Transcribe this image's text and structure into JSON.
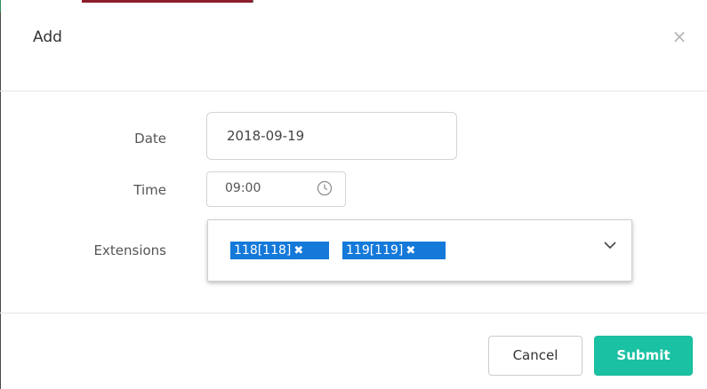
{
  "dialog": {
    "title": "Add",
    "close_glyph": "×"
  },
  "form": {
    "date": {
      "label": "Date",
      "value": "2018-09-19"
    },
    "time": {
      "label": "Time",
      "value": "09:00",
      "icon": "clock-icon"
    },
    "extensions": {
      "label": "Extensions",
      "selected": [
        {
          "label": "118[118]"
        },
        {
          "label": "119[119]"
        }
      ],
      "tag_color": "#1479d9",
      "remove_glyph": "✖",
      "icon": "chevron-down-icon"
    }
  },
  "footer": {
    "cancel_label": "Cancel",
    "submit_label": "Submit",
    "submit_color": "#1ac1a3"
  }
}
